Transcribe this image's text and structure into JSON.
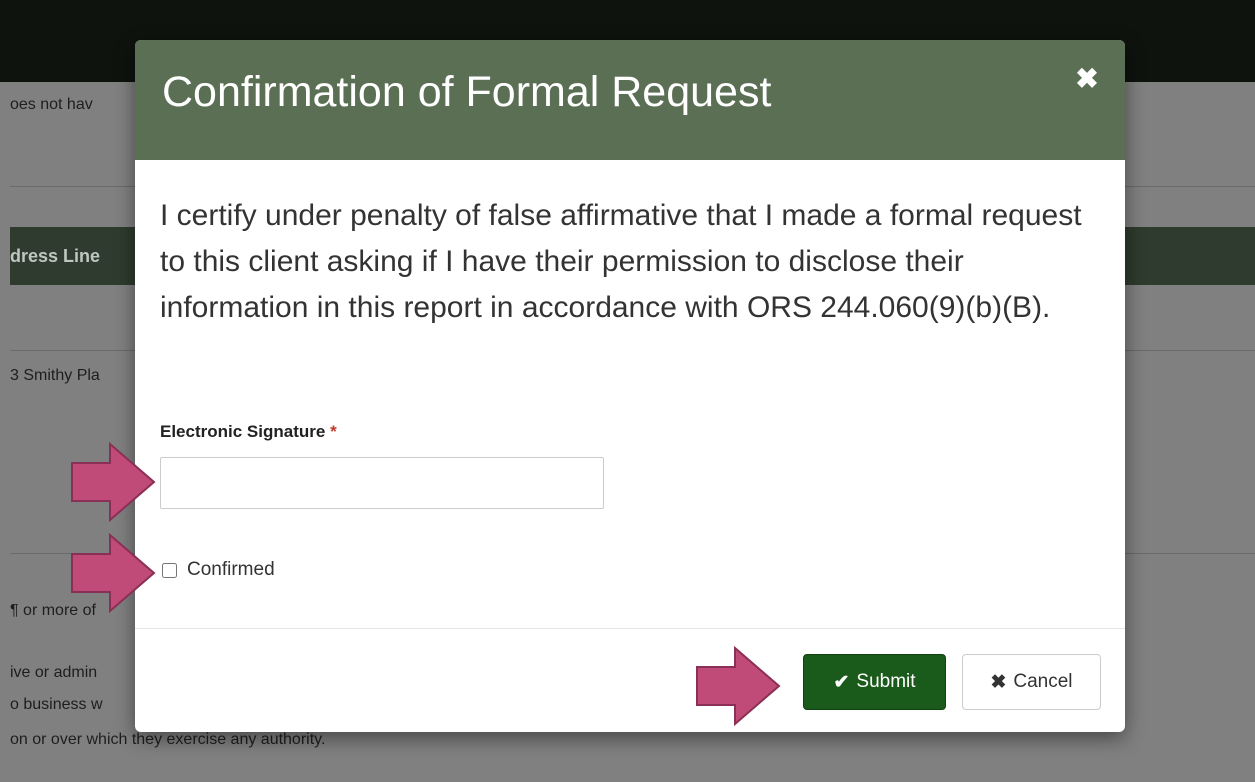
{
  "background": {
    "fragments": [
      "oes not hav",
      "dress Line",
      "3 Smithy Pla",
      "¶ or more of",
      "ive or admin",
      "o business w",
      "on or over which they exercise any authority."
    ]
  },
  "modal": {
    "title": "Confirmation of Formal Request",
    "close_icon": "✖",
    "statement": "I certify under penalty of false affirmative that I made a formal request to this client asking if I have their permission to disclose their information in this report in accordance with ORS 244.060(9)(b)(B).",
    "signature": {
      "label": "Electronic Signature",
      "required_mark": "*",
      "value": "",
      "placeholder": ""
    },
    "confirm": {
      "label": "Confirmed",
      "checked": false
    },
    "footer": {
      "submit_icon": "✔",
      "submit_label": "Submit",
      "cancel_icon": "✖",
      "cancel_label": "Cancel"
    }
  },
  "colors": {
    "header_bg": "#5b6f55",
    "submit_bg": "#1a5a1a",
    "arrow_fill": "#c04a78"
  }
}
